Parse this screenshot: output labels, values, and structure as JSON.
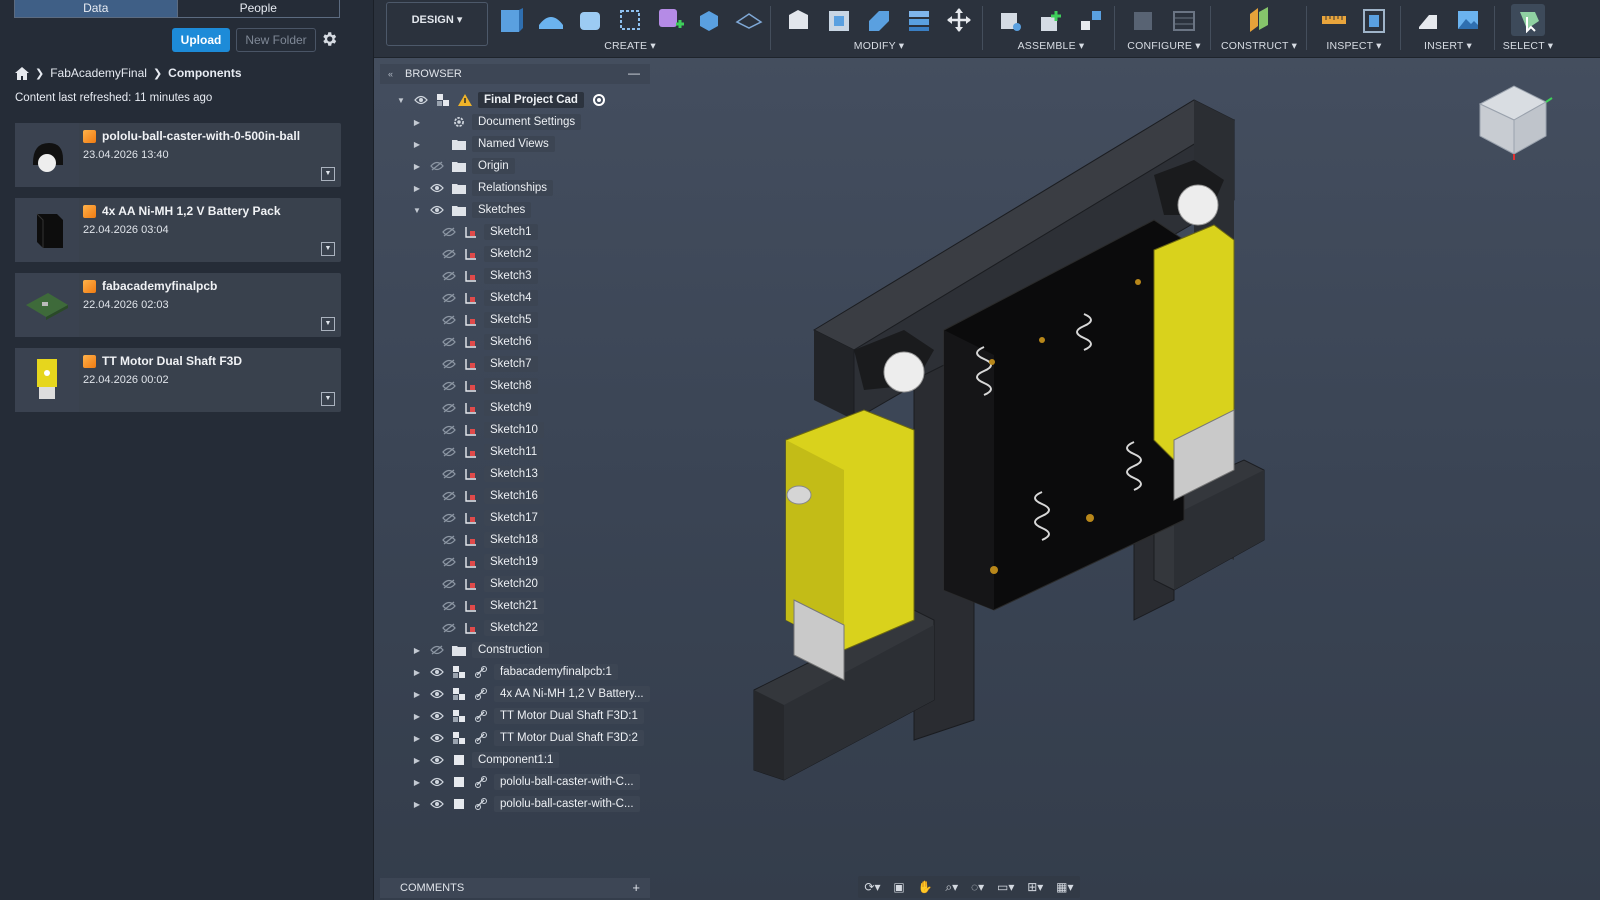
{
  "data_panel": {
    "tabs": [
      {
        "label": "Data",
        "active": true
      },
      {
        "label": "People",
        "active": false
      }
    ],
    "upload_label": "Upload",
    "new_folder_label": "New Folder",
    "breadcrumb": [
      "FabAcademyFinal",
      "Components"
    ],
    "refresh_text": "Content last refreshed: 11 minutes ago",
    "items": [
      {
        "title": "pololu-ball-caster-with-0-500in-ball",
        "date": "23.04.2026 13:40"
      },
      {
        "title": "4x AA Ni-MH 1,2 V Battery Pack",
        "date": "22.04.2026 03:04"
      },
      {
        "title": "fabacademyfinalpcb",
        "date": "22.04.2026 02:03"
      },
      {
        "title": "TT Motor Dual Shaft F3D",
        "date": "22.04.2026 00:02"
      }
    ]
  },
  "toolbar": {
    "design_label": "DESIGN ▾",
    "groups": [
      "CREATE ▾",
      "MODIFY ▾",
      "ASSEMBLE ▾",
      "CONFIGURE ▾",
      "CONSTRUCT ▾",
      "INSPECT ▾",
      "INSERT ▾",
      "SELECT ▾"
    ]
  },
  "browser": {
    "title": "BROWSER",
    "root": "Final Project Cad",
    "items": [
      "Document Settings",
      "Named Views",
      "Origin",
      "Relationships",
      "Sketches",
      "Sketch1",
      "Sketch2",
      "Sketch3",
      "Sketch4",
      "Sketch5",
      "Sketch6",
      "Sketch7",
      "Sketch8",
      "Sketch9",
      "Sketch10",
      "Sketch11",
      "Sketch13",
      "Sketch16",
      "Sketch17",
      "Sketch18",
      "Sketch19",
      "Sketch20",
      "Sketch21",
      "Sketch22",
      "Construction",
      "fabacademyfinalpcb:1",
      "4x AA Ni-MH 1,2 V Battery...",
      "TT Motor Dual Shaft F3D:1",
      "TT Motor Dual Shaft F3D:2",
      "Component1:1",
      "pololu-ball-caster-with-C...",
      "pololu-ball-caster-with-C..."
    ]
  },
  "comments_label": "COMMENTS",
  "colors": {
    "accent": "#1d8bd8",
    "body_yellow": "#d9d21c",
    "chassis": "#2a2d33"
  }
}
